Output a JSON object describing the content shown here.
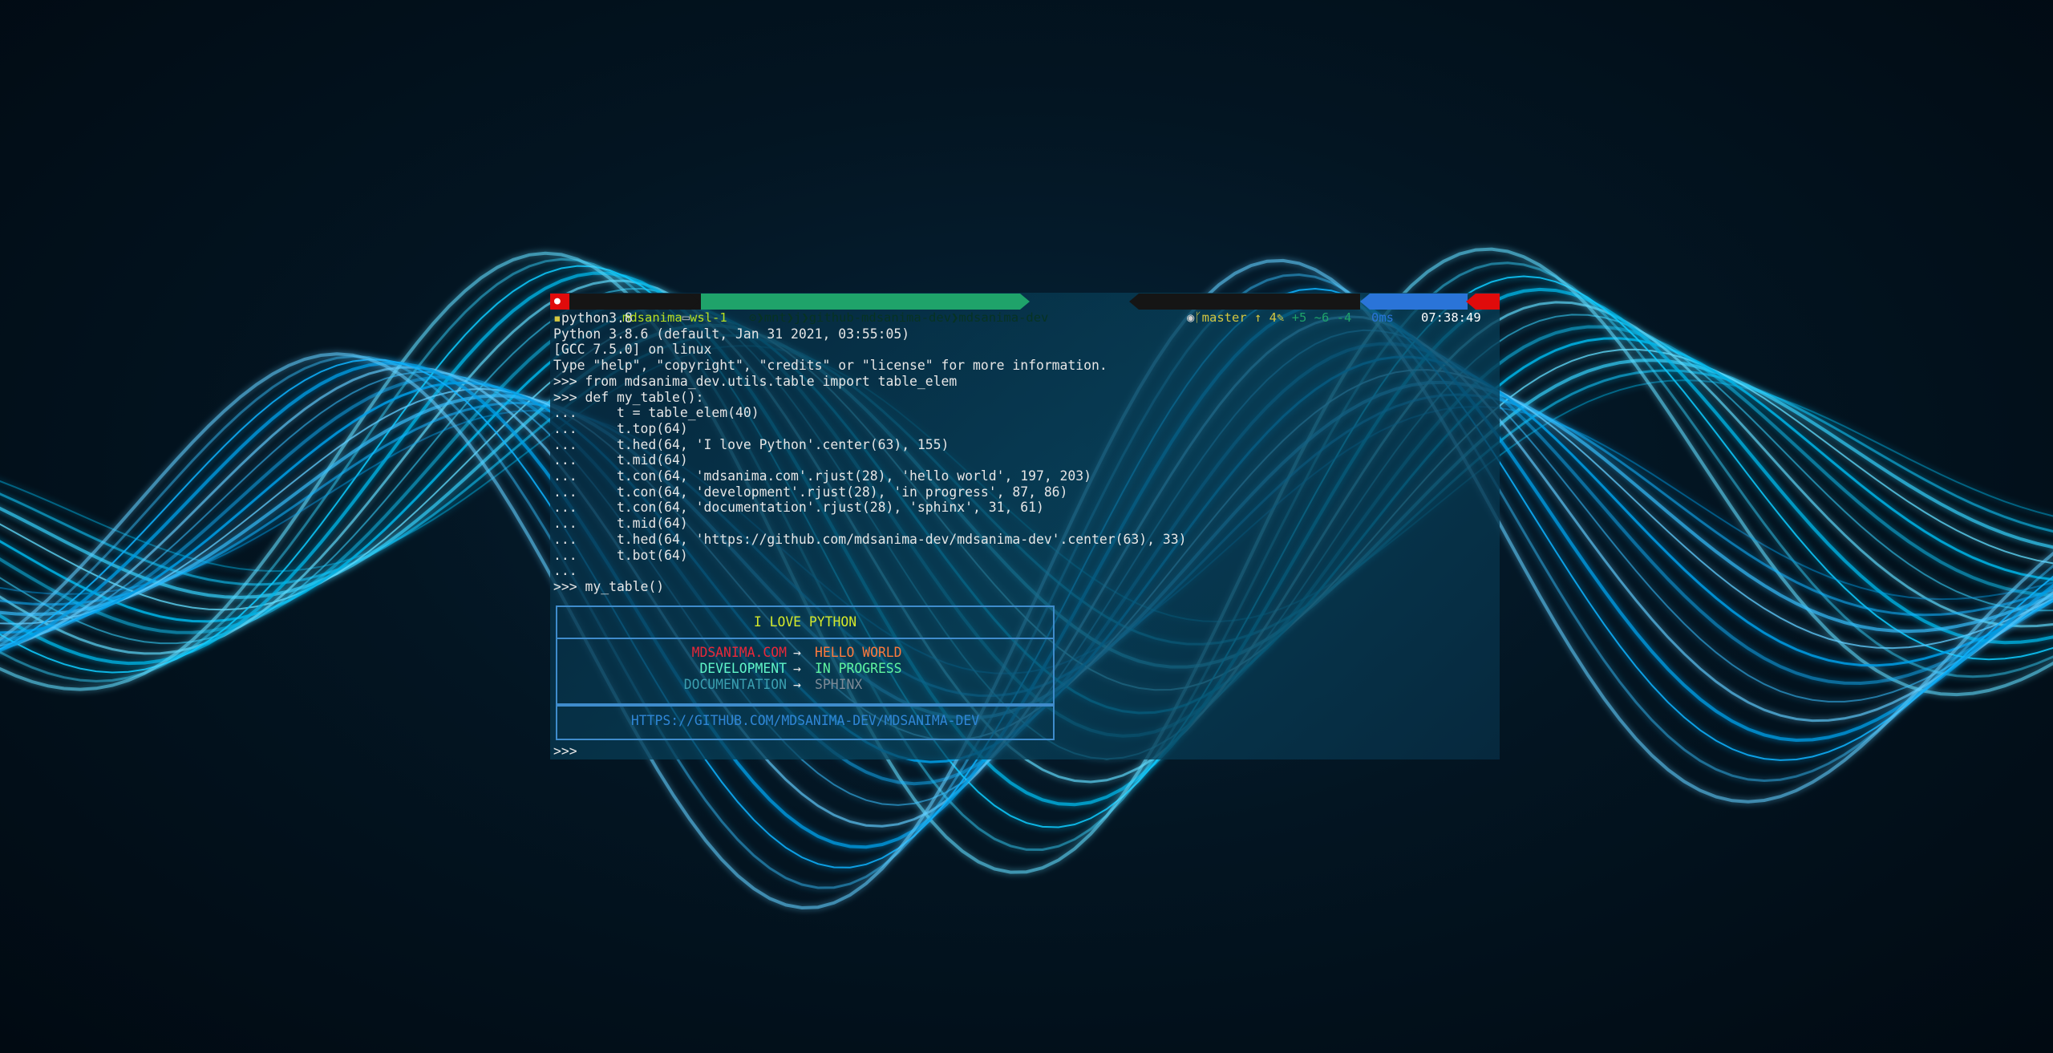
{
  "prompt": {
    "user": "mdsanima",
    "host": "wsl-1",
    "path_parts": [
      "mnt",
      "j",
      "github-mdsanima-dev",
      "mdsanima-dev"
    ],
    "git_branch": "master",
    "git_ahead": "↑ 4",
    "git_status": "+5 ~6 -4",
    "exec_time": "0ms",
    "clock": "07:38:49",
    "colors": {
      "red": "#e00b0b",
      "green": "#1fa36a",
      "dark": "#1a1a1a",
      "blue": "#2a74d8"
    }
  },
  "terminal": {
    "command": "python3.8",
    "lines": [
      "Python 3.8.6 (default, Jan 31 2021, 03:55:05)",
      "[GCC 7.5.0] on linux",
      "Type \"help\", \"copyright\", \"credits\" or \"license\" for more information.",
      ">>> from mdsanima_dev.utils.table import table_elem",
      ">>> def my_table():",
      "...     t = table_elem(40)",
      "...     t.top(64)",
      "...     t.hed(64, 'I love Python'.center(63), 155)",
      "...     t.mid(64)",
      "...     t.con(64, 'mdsanima.com'.rjust(28), 'hello world', 197, 203)",
      "...     t.con(64, 'development'.rjust(28), 'in progress', 87, 86)",
      "...     t.con(64, 'documentation'.rjust(28), 'sphinx', 31, 61)",
      "...     t.mid(64)",
      "...     t.hed(64, 'https://github.com/mdsanima-dev/mdsanima-dev'.center(63), 33)",
      "...     t.bot(64)",
      "...",
      ">>> my_table()"
    ],
    "final_prompt": ">>>"
  },
  "table": {
    "header": "I LOVE PYTHON",
    "rows": [
      {
        "left": "MDSANIMA.COM",
        "arrow": "→",
        "right": "HELLO WORLD",
        "left_color": "#e8283a",
        "right_color": "#ff7a3d"
      },
      {
        "left": "DEVELOPMENT",
        "arrow": "→",
        "right": "IN PROGRESS",
        "left_color": "#5ff5c8",
        "right_color": "#5ff5a0"
      },
      {
        "left": "DOCUMENTATION",
        "arrow": "→",
        "right": "SPHINX",
        "left_color": "#3a9fb0",
        "right_color": "#7d8a96"
      }
    ],
    "footer": "HTTPS://GITHUB.COM/MDSANIMA-DEV/MDSANIMA-DEV",
    "colors": {
      "border": "#3f8ccc",
      "header": "#d4e82a",
      "footer": "#2f86d6"
    }
  }
}
